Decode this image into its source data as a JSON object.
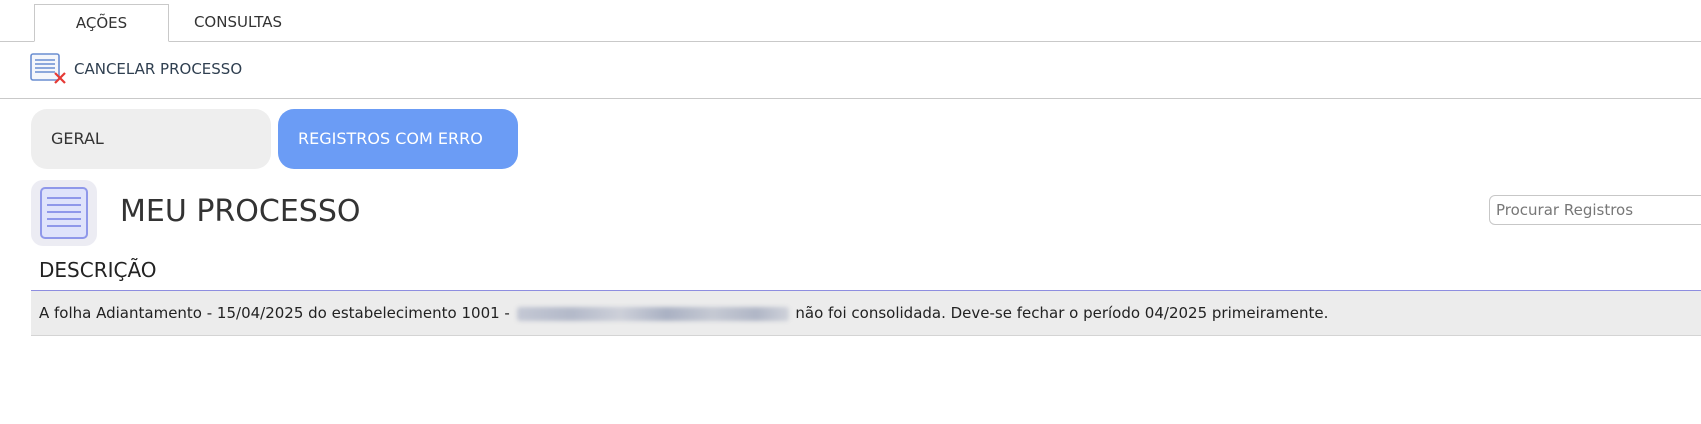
{
  "tabs": [
    {
      "label": "AÇÕES",
      "active": true
    },
    {
      "label": "CONSULTAS",
      "active": false
    }
  ],
  "toolbar": {
    "cancel_label": "CANCELAR PROCESSO",
    "cancel_icon": "document-cancel-icon"
  },
  "segments": [
    {
      "label": "GERAL",
      "selected": false
    },
    {
      "label": "REGISTROS COM ERRO",
      "selected": true
    }
  ],
  "page": {
    "title": "MEU PROCESSO",
    "title_icon": "document-list-icon"
  },
  "search": {
    "placeholder": "Procurar Registros"
  },
  "table": {
    "columns": [
      "DESCRIÇÃO"
    ],
    "rows": [
      {
        "before_redaction": "A folha Adiantamento - 15/04/2025 do estabelecimento 1001 - ",
        "after_redaction": " não foi consolidada. Deve-se fechar o período 04/2025 primeiramente."
      }
    ]
  },
  "colors": {
    "accent": "#6b9cf5",
    "segment_inactive": "#eeeeee",
    "row_bg": "#ececec",
    "header_line": "#8e8ee0"
  }
}
